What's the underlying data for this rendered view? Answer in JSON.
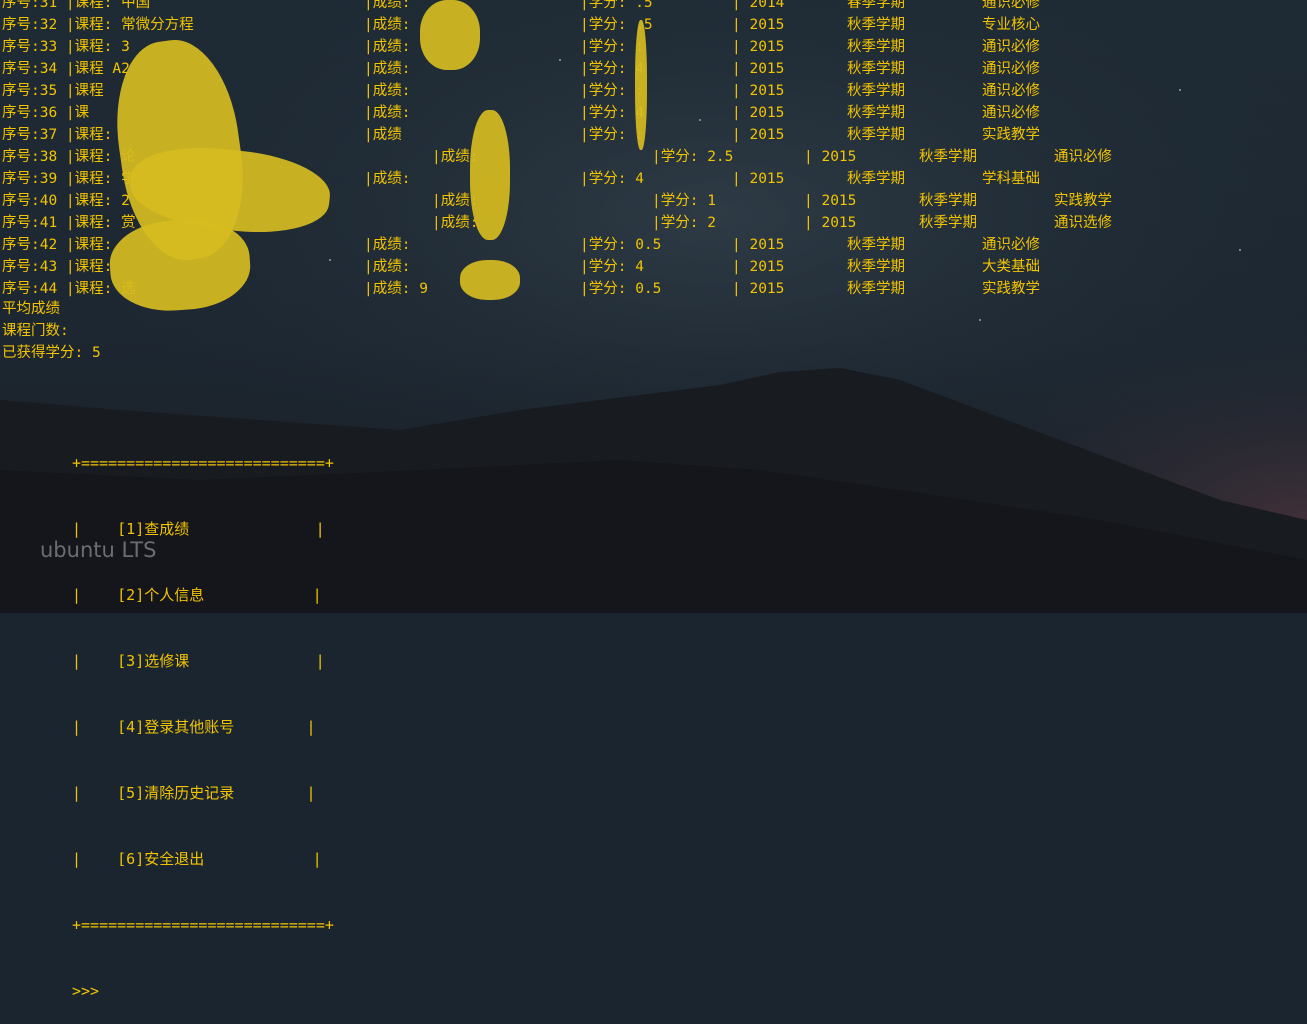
{
  "records": [
    {
      "seq": "序号:31 |课程: 中国",
      "grade": "|成绩:",
      "credit": "|学分: .5",
      "year": "| 2014",
      "term": "春季学期",
      "type": "通识必修"
    },
    {
      "seq": "序号:32 |课程: 常微分方程",
      "grade": "|成绩:",
      "credit": "|学分: .5",
      "year": "| 2015",
      "term": "秋季学期",
      "type": "专业核心"
    },
    {
      "seq": "序号:33 |课程: 3",
      "grade": "|成绩:",
      "credit": "|学分: :",
      "year": "| 2015",
      "term": "秋季学期",
      "type": "通识必修"
    },
    {
      "seq": "序号:34 |课程 A2",
      "grade": "|成绩:",
      "credit": "|学分: 4",
      "year": "| 2015",
      "term": "秋季学期",
      "type": "通识必修"
    },
    {
      "seq": "序号:35 |课程",
      "grade": "|成绩:",
      "credit": "|学分: :",
      "year": "| 2015",
      "term": "秋季学期",
      "type": "通识必修"
    },
    {
      "seq": "序号:36 |课",
      "grade": "|成绩:",
      "credit": "|学分: 4",
      "year": "| 2015",
      "term": "秋季学期",
      "type": "通识必修"
    },
    {
      "seq": "序号:37 |课程:",
      "grade": "|成绩",
      "credit": "|学分: :",
      "year": "| 2015",
      "term": "秋季学期",
      "type": "实践教学"
    },
    {
      "seq": "序号:38 |课程: 论",
      "grade": "|成绩:",
      "credit": "|学分: 2.5",
      "year": "| 2015",
      "term": "秋季学期",
      "type": "通识必修"
    },
    {
      "seq": "序号:39 |课程: 学分析3",
      "grade": "|成绩:",
      "credit": "|学分: 4",
      "year": "| 2015",
      "term": "秋季学期",
      "type": "学科基础"
    },
    {
      "seq": "序号:40 |课程: 2",
      "grade": "|成绩:",
      "credit": "|学分: 1",
      "year": "| 2015",
      "term": "秋季学期",
      "type": "实践教学"
    },
    {
      "seq": "序号:41 |课程: 赏",
      "grade": "|成绩:",
      "credit": "|学分: 2",
      "year": "| 2015",
      "term": "秋季学期",
      "type": "通识选修"
    },
    {
      "seq": "序号:42 |课程:",
      "grade": "|成绩:",
      "credit": "|学分: 0.5",
      "year": "| 2015",
      "term": "秋季学期",
      "type": "通识必修"
    },
    {
      "seq": "序号:43 |课程:",
      "grade": "|成绩:",
      "credit": "|学分: 4",
      "year": "| 2015",
      "term": "秋季学期",
      "type": "大类基础"
    },
    {
      "seq": "序号:44 |课程: 选",
      "grade": "|成绩: 9",
      "credit": "|学分: 0.5",
      "year": "| 2015",
      "term": "秋季学期",
      "type": "实践教学"
    }
  ],
  "summary": {
    "avg": "平均成绩",
    "count": "课程门数:",
    "credits": "已获得学分: 5"
  },
  "menu": {
    "border": "+===========================+",
    "items": [
      {
        "label": "|    [1]查成绩              |"
      },
      {
        "label": "|    [2]个人信息            |"
      },
      {
        "label": "|    [3]选修课              |"
      },
      {
        "label": "|    [4]登录其他账号        |"
      },
      {
        "label": "|    [5]清除历史记录        |"
      },
      {
        "label": "|    [6]安全退出            |"
      }
    ],
    "prompt": ">>>"
  },
  "desktop_watermark": "ubuntu LTS",
  "colors": {
    "text": "#f2c400",
    "background": "#1b2530"
  }
}
